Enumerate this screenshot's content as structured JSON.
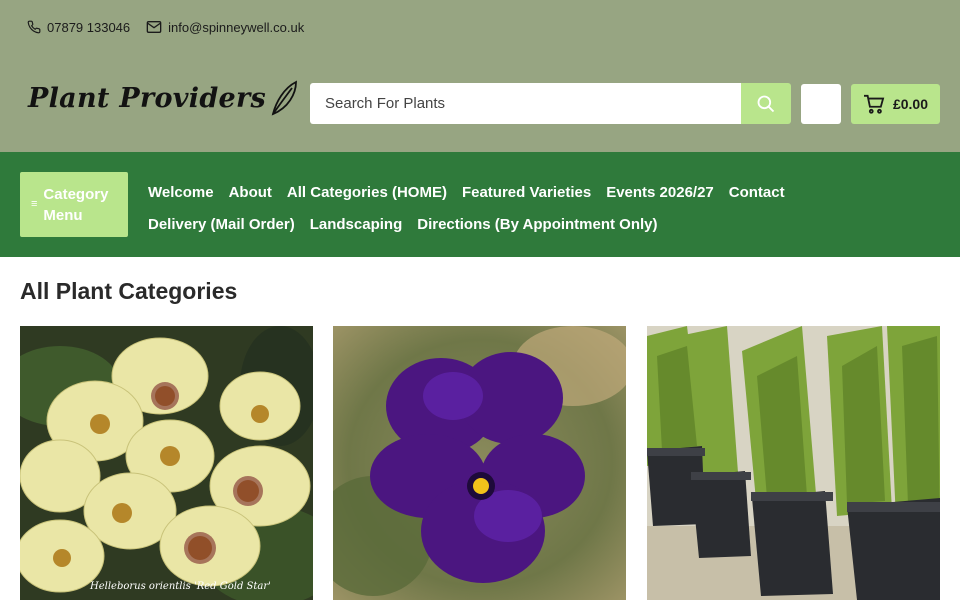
{
  "contact": {
    "phone": "07879 133046",
    "email": "info@spinneywell.co.uk"
  },
  "logo": {
    "text": "Plant Providers"
  },
  "search": {
    "placeholder": "Search For Plants"
  },
  "cart": {
    "total": "£0.00"
  },
  "category_menu": {
    "line1": "Category",
    "line2": "Menu"
  },
  "nav": {
    "row1": [
      "Welcome",
      "About",
      "All Categories (HOME)",
      "Featured Varieties",
      "Events 2026/27",
      "Contact"
    ],
    "row2": [
      "Delivery (Mail Order)",
      "Landscaping",
      "Directions (By Appointment Only)"
    ]
  },
  "page": {
    "title": "All Plant Categories"
  },
  "cards": [
    {
      "caption": "Helleborus orientlis 'Red Gold Star'"
    },
    {
      "caption": ""
    },
    {
      "caption": ""
    }
  ],
  "colors": {
    "header_bg": "#97a582",
    "nav_bg": "#2f7a3b",
    "accent": "#b9e58c"
  },
  "icons": {
    "phone": "phone-icon",
    "email": "envelope-icon",
    "search": "search-icon",
    "cart": "cart-icon",
    "leaf": "leaf-icon",
    "menu": "hamburger-icon"
  }
}
